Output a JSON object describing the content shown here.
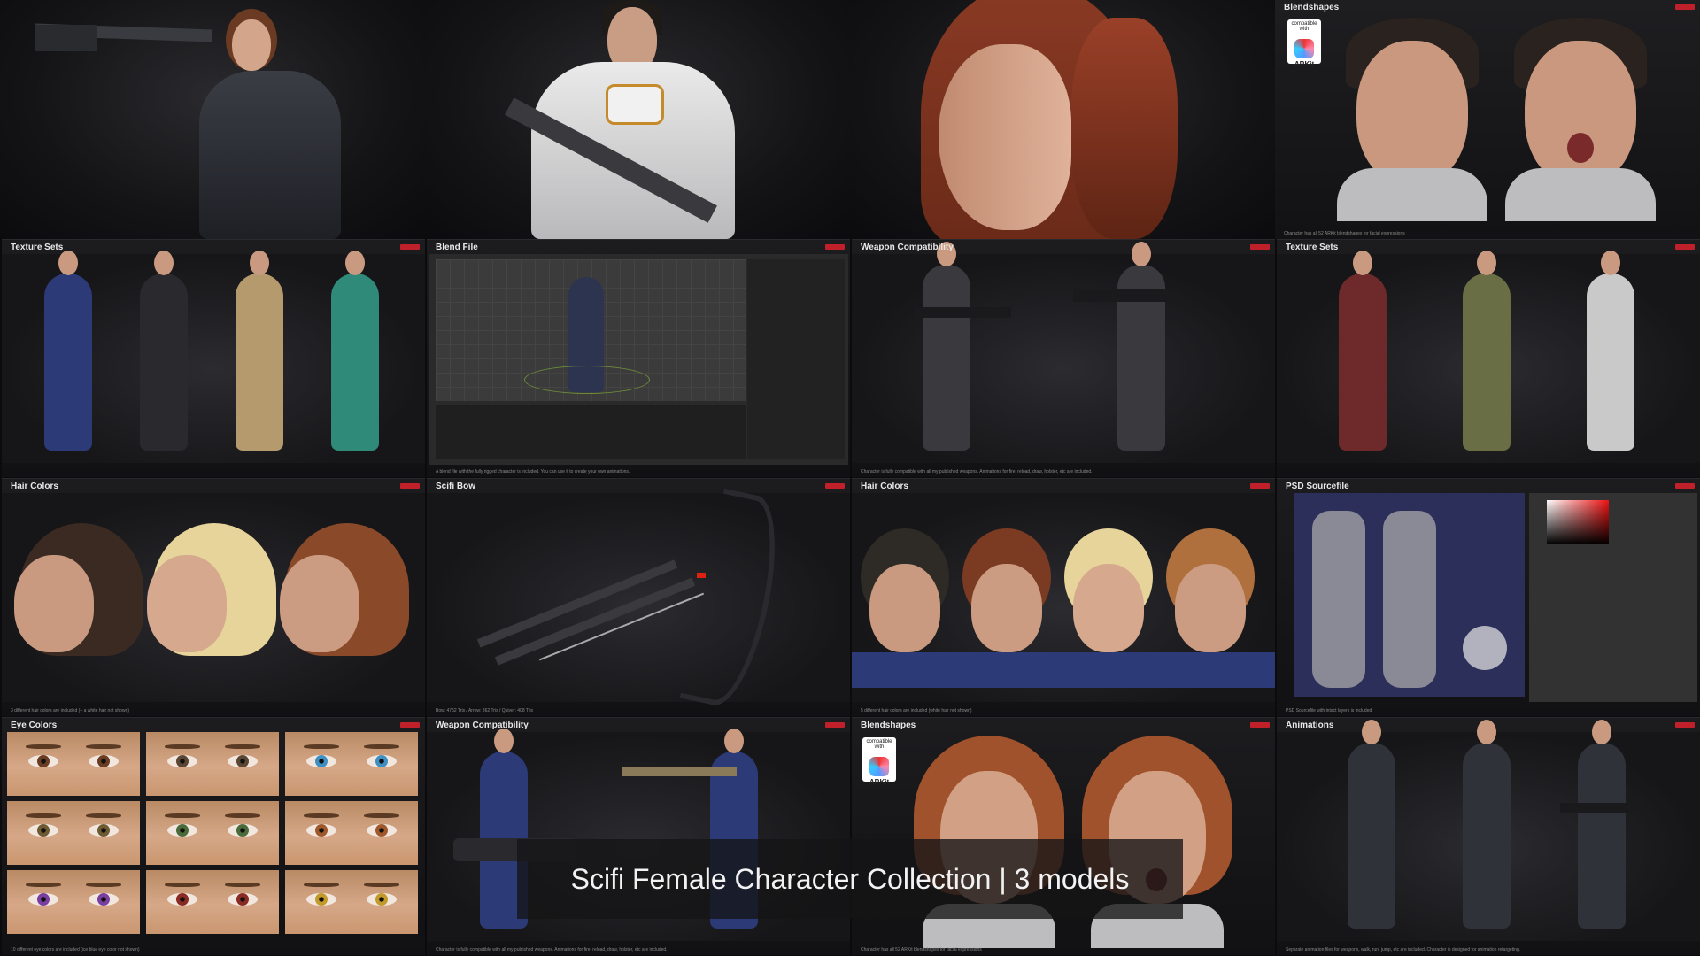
{
  "banner": {
    "text": "Scifi Female Character Collection | 3 models"
  },
  "hero_blendshapes": {
    "title": "Blendshapes",
    "caption": "Character has all 52 ARKit blendshapes for facial expressions",
    "arkit_top": "compatible with",
    "arkit_label": "ARKit"
  },
  "tiles": {
    "t1": {
      "title": "Texture Sets",
      "caption": ""
    },
    "t2": {
      "title": "Blend File",
      "caption": "A blend file with the fully rigged character is included. You can use it to create your own animations."
    },
    "t3": {
      "title": "Weapon Compatibility",
      "caption": "Character is fully compatible with all my published weapons. Animations for fire, reload, draw, holster, etc are included."
    },
    "t4": {
      "title": "Texture Sets",
      "caption": ""
    },
    "t5": {
      "title": "Hair Colors",
      "caption": "3 different hair colors are included (+ a white hair not shown)"
    },
    "t6": {
      "title": "Scifi Bow",
      "caption": "Bow: 4752 Tris / Arrow: 862 Tris / Quiver: 408 Tris"
    },
    "t7": {
      "title": "Hair Colors",
      "caption": "5 different hair colors are included (white hair not shown)"
    },
    "t8": {
      "title": "PSD Sourcefile",
      "caption": "PSD Sourcefile with intact layers is included"
    },
    "t9": {
      "title": "Eye Colors",
      "caption": "10 different eye colors are included (ice blue eye color not shown)"
    },
    "t10": {
      "title": "Weapon Compatibility",
      "caption": "Character is fully compatible with all my published weapons. Animations for fire, reload, draw, holster, etc are included."
    },
    "t11": {
      "title": "Blendshapes",
      "caption": "Character has all 52 ARKit blendshapes for facial expressions",
      "arkit_top": "compatible with",
      "arkit_label": "ARKit"
    },
    "t12": {
      "title": "Animations",
      "caption": "Separate animation files for weapons, walk, run, jump, etc are included. Character is designed for animation retargeting."
    }
  },
  "colors": {
    "badge": "#c0202a",
    "suit_blue": "#2c3a78",
    "suit_black": "#2a2a2e",
    "suit_tan": "#b59a6e",
    "suit_teal": "#2f8a7a",
    "suit_red": "#6e2a2a",
    "suit_olive": "#6a6e44",
    "suit_white": "#c9c9c9",
    "hair_brown": "#7a3b22",
    "hair_blonde": "#e6d49a",
    "hair_dark": "#3a2a22",
    "hair_auburn": "#8a4a2a"
  },
  "eye_colors": [
    "#6a3c22",
    "#5a4632",
    "#3e8fc2",
    "#6e5a32",
    "#4a6a3a",
    "#a0582a",
    "#7a3ea0",
    "#8a2a22",
    "#c29a2a"
  ]
}
